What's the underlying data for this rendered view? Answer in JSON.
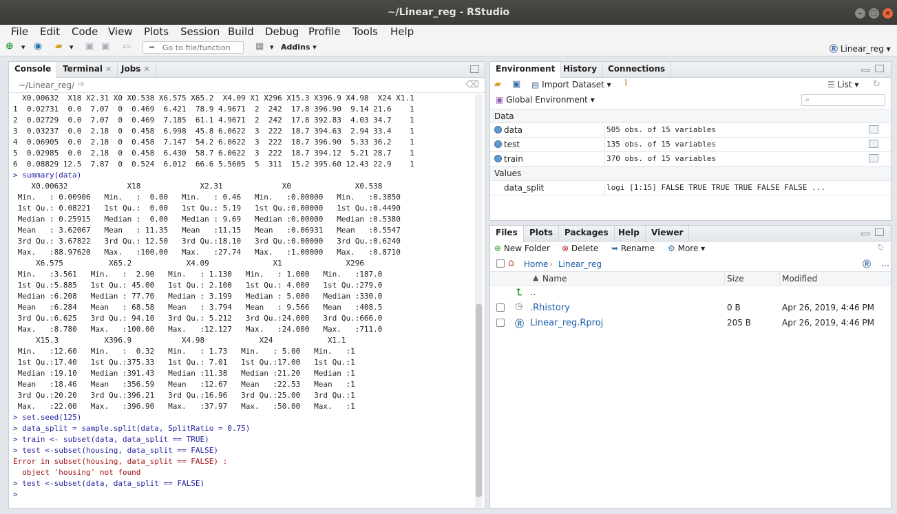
{
  "window": {
    "title": "~/Linear_reg - RStudio"
  },
  "menu": [
    "File",
    "Edit",
    "Code",
    "View",
    "Plots",
    "Session",
    "Build",
    "Debug",
    "Profile",
    "Tools",
    "Help"
  ],
  "toolbar": {
    "goto_placeholder": "Go to file/function",
    "addins": "Addins",
    "project": "Linear_reg"
  },
  "console": {
    "tabs": [
      "Console",
      "Terminal",
      "Jobs"
    ],
    "path": "~/Linear_reg/",
    "lines": [
      {
        "t": "  X0.00632  X18 X2.31 X0 X0.538 X6.575 X65.2  X4.09 X1 X296 X15.3 X396.9 X4.98  X24 X1.1",
        "c": "out"
      },
      {
        "t": "1  0.02731  0.0  7.07  0  0.469  6.421  78.9 4.9671  2  242  17.8 396.90  9.14 21.6    1",
        "c": "out"
      },
      {
        "t": "2  0.02729  0.0  7.07  0  0.469  7.185  61.1 4.9671  2  242  17.8 392.83  4.03 34.7    1",
        "c": "out"
      },
      {
        "t": "3  0.03237  0.0  2.18  0  0.458  6.998  45.8 6.0622  3  222  18.7 394.63  2.94 33.4    1",
        "c": "out"
      },
      {
        "t": "4  0.06905  0.0  2.18  0  0.458  7.147  54.2 6.0622  3  222  18.7 396.90  5.33 36.2    1",
        "c": "out"
      },
      {
        "t": "5  0.02985  0.0  2.18  0  0.458  6.430  58.7 6.0622  3  222  18.7 394.12  5.21 28.7    1",
        "c": "out"
      },
      {
        "t": "6  0.08829 12.5  7.87  0  0.524  6.012  66.6 5.5605  5  311  15.2 395.60 12.43 22.9    1",
        "c": "out"
      },
      {
        "t": "> summary(data)",
        "c": "prompt"
      },
      {
        "t": "    X0.00632             X18             X2.31             X0              X0.538      ",
        "c": "out"
      },
      {
        "t": " Min.   : 0.00906   Min.   :  0.00   Min.   : 0.46   Min.   :0.00000   Min.   :0.3850  ",
        "c": "out"
      },
      {
        "t": " 1st Qu.: 0.08221   1st Qu.:  0.00   1st Qu.: 5.19   1st Qu.:0.00000   1st Qu.:0.4490  ",
        "c": "out"
      },
      {
        "t": " Median : 0.25915   Median :  0.00   Median : 9.69   Median :0.00000   Median :0.5380  ",
        "c": "out"
      },
      {
        "t": " Mean   : 3.62067   Mean   : 11.35   Mean   :11.15   Mean   :0.06931   Mean   :0.5547  ",
        "c": "out"
      },
      {
        "t": " 3rd Qu.: 3.67822   3rd Qu.: 12.50   3rd Qu.:18.10   3rd Qu.:0.00000   3rd Qu.:0.6240  ",
        "c": "out"
      },
      {
        "t": " Max.   :88.97620   Max.   :100.00   Max.   :27.74   Max.   :1.00000   Max.   :0.8710  ",
        "c": "out"
      },
      {
        "t": "     X6.575          X65.2            X4.09              X1              X296      ",
        "c": "out"
      },
      {
        "t": " Min.   :3.561   Min.   :  2.90   Min.   : 1.130   Min.   : 1.000   Min.   :187.0  ",
        "c": "out"
      },
      {
        "t": " 1st Qu.:5.885   1st Qu.: 45.00   1st Qu.: 2.100   1st Qu.: 4.000   1st Qu.:279.0  ",
        "c": "out"
      },
      {
        "t": " Median :6.208   Median : 77.70   Median : 3.199   Median : 5.000   Median :330.0  ",
        "c": "out"
      },
      {
        "t": " Mean   :6.284   Mean   : 68.58   Mean   : 3.794   Mean   : 9.566   Mean   :408.5  ",
        "c": "out"
      },
      {
        "t": " 3rd Qu.:6.625   3rd Qu.: 94.10   3rd Qu.: 5.212   3rd Qu.:24.000   3rd Qu.:666.0  ",
        "c": "out"
      },
      {
        "t": " Max.   :8.780   Max.   :100.00   Max.   :12.127   Max.   :24.000   Max.   :711.0  ",
        "c": "out"
      },
      {
        "t": "     X15.3          X396.9           X4.98            X24            X1.1  ",
        "c": "out"
      },
      {
        "t": " Min.   :12.60   Min.   :  0.32   Min.   : 1.73   Min.   : 5.00   Min.   :1  ",
        "c": "out"
      },
      {
        "t": " 1st Qu.:17.40   1st Qu.:375.33   1st Qu.: 7.01   1st Qu.:17.00   1st Qu.:1  ",
        "c": "out"
      },
      {
        "t": " Median :19.10   Median :391.43   Median :11.38   Median :21.20   Median :1  ",
        "c": "out"
      },
      {
        "t": " Mean   :18.46   Mean   :356.59   Mean   :12.67   Mean   :22.53   Mean   :1  ",
        "c": "out"
      },
      {
        "t": " 3rd Qu.:20.20   3rd Qu.:396.21   3rd Qu.:16.96   3rd Qu.:25.00   3rd Qu.:1  ",
        "c": "out"
      },
      {
        "t": " Max.   :22.00   Max.   :396.90   Max.   :37.97   Max.   :50.00   Max.   :1  ",
        "c": "out"
      },
      {
        "t": "> set.seed(125)",
        "c": "prompt"
      },
      {
        "t": "> data_split = sample.split(data, SplitRatio = 0.75)",
        "c": "prompt"
      },
      {
        "t": "> train <- subset(data, data_split == TRUE)",
        "c": "prompt"
      },
      {
        "t": "> test <-subset(housing, data_split == FALSE)",
        "c": "prompt"
      },
      {
        "t": "Error in subset(housing, data_split == FALSE) : ",
        "c": "err"
      },
      {
        "t": "  object 'housing' not found",
        "c": "err"
      },
      {
        "t": "> test <-subset(data, data_split == FALSE)",
        "c": "prompt"
      },
      {
        "t": "> ",
        "c": "prompt"
      }
    ]
  },
  "env": {
    "tabs": [
      "Environment",
      "History",
      "Connections"
    ],
    "import_dataset": "Import Dataset",
    "list_label": "List",
    "global_env": "Global Environment",
    "section_data": "Data",
    "section_values": "Values",
    "data_rows": [
      {
        "name": "data",
        "value": "505 obs. of 15 variables"
      },
      {
        "name": "test",
        "value": "135 obs. of 15 variables"
      },
      {
        "name": "train",
        "value": "370 obs. of 15 variables"
      }
    ],
    "value_rows": [
      {
        "name": "data_split",
        "value": "logi [1:15] FALSE TRUE TRUE TRUE FALSE FALSE ..."
      }
    ]
  },
  "files": {
    "tabs": [
      "Files",
      "Plots",
      "Packages",
      "Help",
      "Viewer"
    ],
    "new_folder": "New Folder",
    "delete": "Delete",
    "rename": "Rename",
    "more": "More",
    "breadcrumb_home": "Home",
    "breadcrumb_dir": "Linear_reg",
    "col_name": "Name",
    "col_size": "Size",
    "col_modified": "Modified",
    "up": "..",
    "rows": [
      {
        "name": ".Rhistory",
        "size": "0 B",
        "modified": "Apr 26, 2019, 4:46 PM"
      },
      {
        "name": "Linear_reg.Rproj",
        "size": "205 B",
        "modified": "Apr 26, 2019, 4:46 PM"
      }
    ]
  }
}
